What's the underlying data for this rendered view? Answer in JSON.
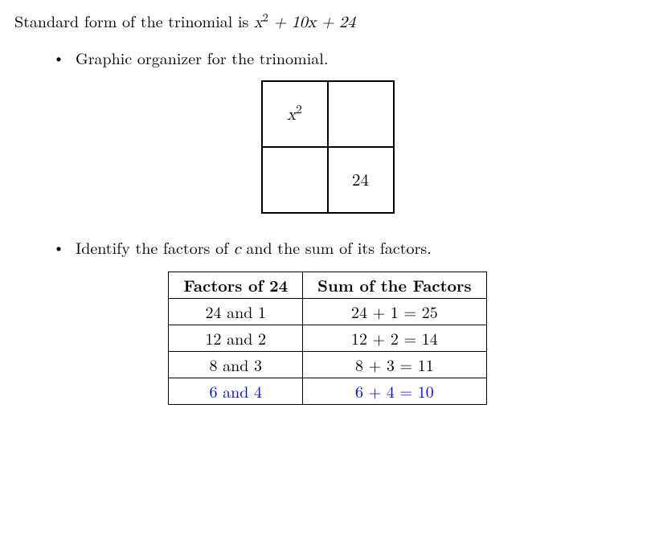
{
  "intro": {
    "prefix": "Standard form of the trinomial is ",
    "trinomial_a": "x",
    "trinomial_a_exp": "2",
    "trinomial_rest": " + 10x + 24"
  },
  "bullets": {
    "b1": "Graphic organizer for the trinomial.",
    "b2_pre": "Identify the factors of ",
    "b2_var": "c",
    "b2_post": " and the sum of its factors."
  },
  "grid": {
    "tl_var": "x",
    "tl_exp": "2",
    "tr": "",
    "bl": "",
    "br": "24"
  },
  "table": {
    "h1": "Factors of 24",
    "h2": "Sum of the Factors",
    "rows": [
      {
        "f": "24 and 1",
        "s": "24 + 1 = 25",
        "hl": false
      },
      {
        "f": "12 and 2",
        "s": "12 + 2 = 14",
        "hl": false
      },
      {
        "f": "8 and 3",
        "s": "8 + 3 = 11",
        "hl": false
      },
      {
        "f": "6 and 4",
        "s": "6 + 4 = 10",
        "hl": true
      }
    ]
  }
}
